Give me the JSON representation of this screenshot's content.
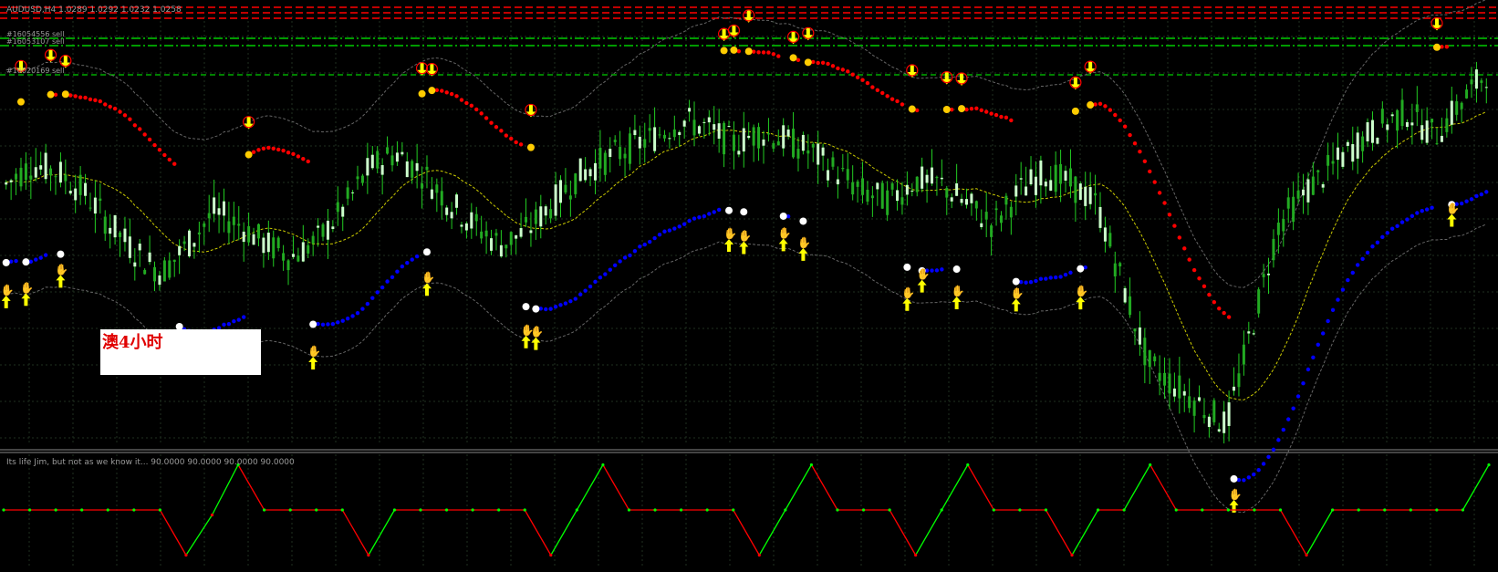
{
  "colors": {
    "background": "#000000",
    "grid": "#1f2f1f",
    "bull_candle": "#ccffcc",
    "bear_candle": "#22aa22",
    "wick": "#22cc22",
    "sell_line": "#ff0000",
    "buy_line": "#0000ff",
    "envelope_mid": "#cccc00",
    "envelope_outer": "#666666",
    "order_line": "#00cc00",
    "stop_line": "#ff0000",
    "osc_up": "#00ff00",
    "osc_down": "#ff0000"
  },
  "header": {
    "symbol_info": "AUDUSD,H4  1.0289 1.0292 1.0232 1.0258"
  },
  "orders": [
    {
      "label": "#16054556 sell"
    },
    {
      "label": "#16053107 sell"
    },
    {
      "label": "#16020169 sell"
    }
  ],
  "annotation": {
    "text": "澳4小时"
  },
  "oscillator": {
    "label": "Its life Jim, but not as we know it...  90.0000 90.0000 90.0000 90.0000"
  },
  "icons": {
    "sell_arrow": "down-arrow-icon",
    "buy_arrow": "up-arrow-icon",
    "hand": "hand-icon",
    "dot": "trend-start-dot-icon"
  },
  "chart_data": [
    {
      "type": "line",
      "title": "AUDUSD,H4  1.0289 1.0292 1.0232 1.0258",
      "series": [
        {
          "values": [
            1.0,
            1.005,
            1.003,
            0.998,
            0.99,
            0.983,
            0.978,
            0.985,
            0.993,
            0.99,
            0.985,
            0.982,
            0.986,
            0.994,
            1.004,
            1.008,
            1.003,
            0.996,
            0.99,
            0.985,
            0.988,
            0.995,
            1.002,
            1.006,
            1.009,
            1.012,
            1.016,
            1.014,
            1.01,
            1.013,
            1.011,
            1.008,
            1.003,
            0.998,
            0.996,
            1.001,
            1.0,
            0.995,
            0.99,
            0.998,
            1.003,
            1.0,
            0.995,
            0.975,
            0.955,
            0.95,
            0.945,
            0.94,
            0.965,
            0.99,
            0.998,
            1.004,
            1.01,
            1.015,
            1.018,
            1.012,
            1.02,
            1.028
          ]
        }
      ]
    },
    {
      "type": "line",
      "title": "Its life Jim, but not as we know it...",
      "series": [
        {
          "values": [
            50,
            50,
            50,
            50,
            50,
            50,
            50,
            5,
            45,
            95,
            50,
            50,
            50,
            50,
            5,
            50,
            50,
            50,
            50,
            50,
            50,
            5,
            50,
            95,
            50,
            50,
            50,
            50,
            50,
            5,
            50,
            95,
            50,
            50,
            50,
            5,
            50,
            95,
            50,
            50,
            50,
            5,
            50,
            50,
            95,
            50,
            50,
            50,
            50,
            50,
            5,
            50,
            50,
            50,
            50,
            50,
            50,
            95
          ]
        }
      ]
    }
  ]
}
